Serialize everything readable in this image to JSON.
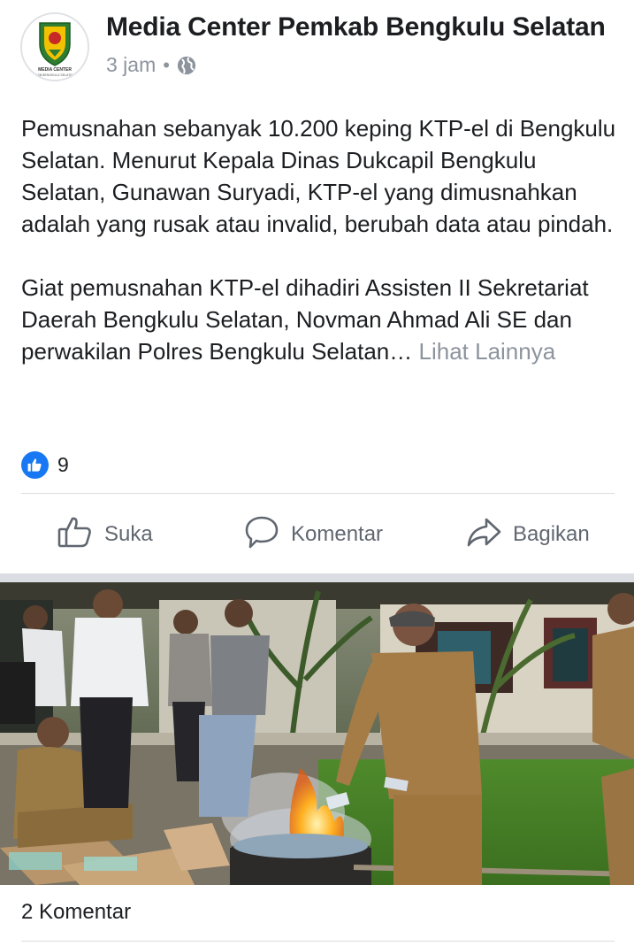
{
  "post": {
    "page_name": "Media Center Pemkab Bengkulu Selatan",
    "time": "3 jam",
    "separator": "•",
    "privacy_icon": "globe-icon",
    "logo_text": "MEDIA CENTER",
    "logo_subtext": "KAB BENGKULU SELATAN",
    "paragraph_1": "Pemusnahan sebanyak 10.200 keping KTP-el di Bengkulu Selatan. Menurut Kepala Dinas Dukcapil Bengkulu Selatan, Gunawan Suryadi, KTP-el yang dimusnahkan adalah yang rusak atau invalid, berubah data atau pindah.",
    "paragraph_2": "Giat pemusnahan KTP-el dihadiri Assisten II Sekretariat Daerah Bengkulu Selatan, Novman Ahmad Ali SE dan perwakilan Polres Bengkulu Selatan…",
    "see_more": "Lihat Lainnya"
  },
  "reactions": {
    "icon": "like-icon",
    "count": "9",
    "color": "#1877f2"
  },
  "actions": {
    "like": {
      "label": "Suka",
      "icon": "thumbs-up-icon"
    },
    "comment": {
      "label": "Komentar",
      "icon": "comment-icon"
    },
    "share": {
      "label": "Bagikan",
      "icon": "share-icon"
    }
  },
  "photo": {
    "type": "outdoor-photo"
  },
  "comments": {
    "label": "2 Komentar"
  }
}
